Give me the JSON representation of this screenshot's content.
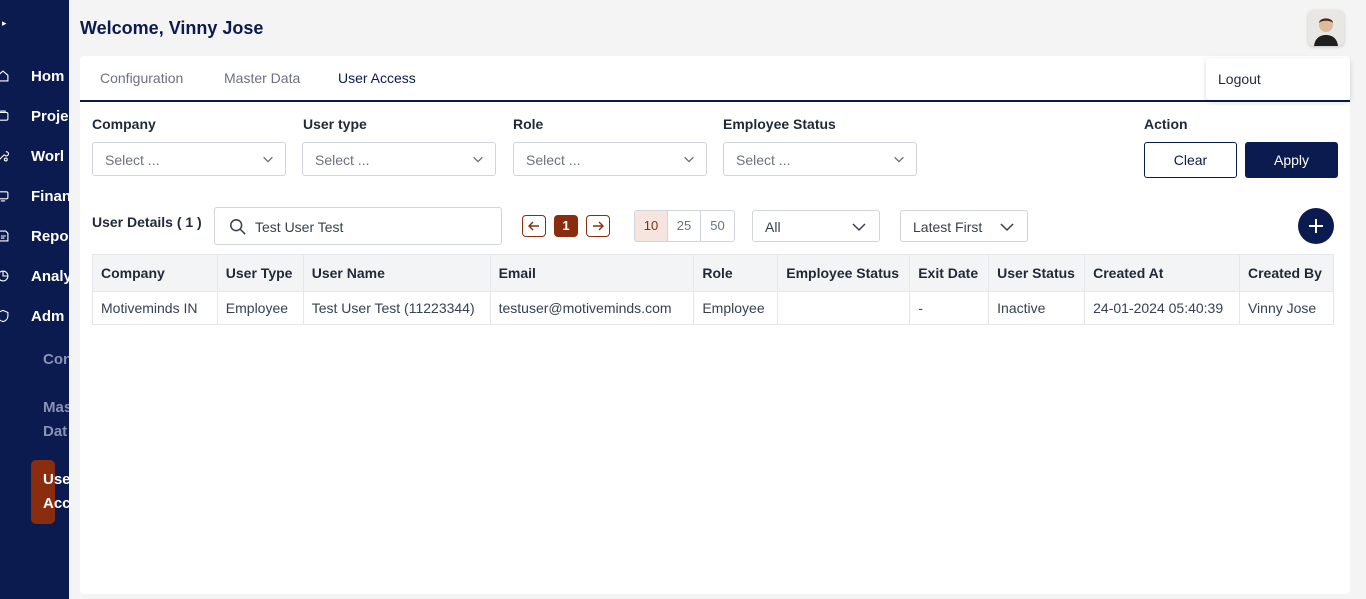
{
  "sidebar": {
    "items": [
      {
        "label": "Home",
        "icon": "home-icon"
      },
      {
        "label": "Projects",
        "icon": "projects-icon"
      },
      {
        "label": "Workflow",
        "icon": "tools-icon"
      },
      {
        "label": "Finance",
        "icon": "finance-icon"
      },
      {
        "label": "Reports",
        "icon": "reports-icon"
      },
      {
        "label": "Analytics",
        "icon": "analytics-icon"
      },
      {
        "label": "Admin",
        "icon": "shield-icon"
      }
    ],
    "sub_items": [
      "Configuration",
      "Master Data",
      "User Access"
    ],
    "sub_lines": {
      "configuration": "Con",
      "master_1": "Mas",
      "master_2": "Dat",
      "user_1": "Use",
      "user_2": "Acc"
    },
    "item_clipped": [
      "Hom",
      "Proje",
      "Worl",
      "Finan",
      "Repo",
      "Analy",
      "Adm"
    ]
  },
  "header": {
    "welcome": "Welcome, Vinny Jose"
  },
  "tabs": [
    {
      "label": "Configuration"
    },
    {
      "label": "Master Data"
    },
    {
      "label": "User Access"
    }
  ],
  "user_menu": {
    "logout": "Logout"
  },
  "filters": {
    "company": {
      "label": "Company",
      "placeholder": "Select ..."
    },
    "user_type": {
      "label": "User type",
      "placeholder": "Select ..."
    },
    "role": {
      "label": "Role",
      "placeholder": "Select ..."
    },
    "employee_status": {
      "label": "Employee Status",
      "placeholder": "Select ..."
    },
    "action_label": "Action",
    "clear": "Clear",
    "apply": "Apply"
  },
  "list": {
    "title": "User Details ( 1 )",
    "search_value": "Test User Test",
    "current_page": "1",
    "page_sizes": [
      "10",
      "25",
      "50"
    ],
    "active_page_size": "10",
    "status_filter": "All",
    "sort": "Latest First"
  },
  "table": {
    "columns": [
      "Company",
      "User Type",
      "User Name",
      "Email",
      "Role",
      "Employee Status",
      "Exit Date",
      "User Status",
      "Created At",
      "Created By"
    ],
    "rows": [
      [
        "Motiveminds IN",
        "Employee",
        "Test User Test (11223344)",
        "testuser@motiveminds.com",
        "Employee",
        "",
        "-",
        "Inactive",
        "24-01-2024 05:40:39",
        "Vinny Jose"
      ]
    ]
  },
  "colors": {
    "navy": "#0b1a4f",
    "accent": "#8a2d0e"
  }
}
